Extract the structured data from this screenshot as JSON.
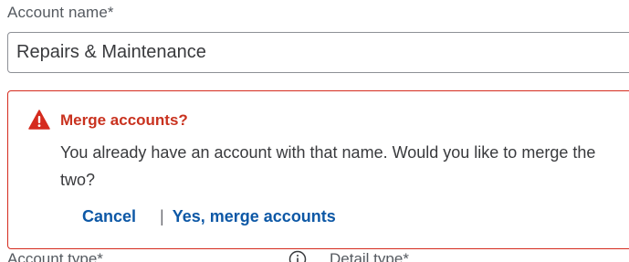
{
  "account_name": {
    "label": "Account name*",
    "value": "Repairs & Maintenance"
  },
  "merge_alert": {
    "icon": "warning-icon",
    "title": "Merge accounts?",
    "message": "You already have an account with that name. Would you like to merge the two?",
    "cancel_label": "Cancel",
    "separator": "|",
    "confirm_label": "Yes, merge accounts",
    "accent_color": "#d52b1e",
    "link_color": "#0d58a6"
  },
  "lower_fields": {
    "account_type_label": "Account type*",
    "info_icon": "info-icon",
    "detail_type_label": "Detail type*"
  }
}
